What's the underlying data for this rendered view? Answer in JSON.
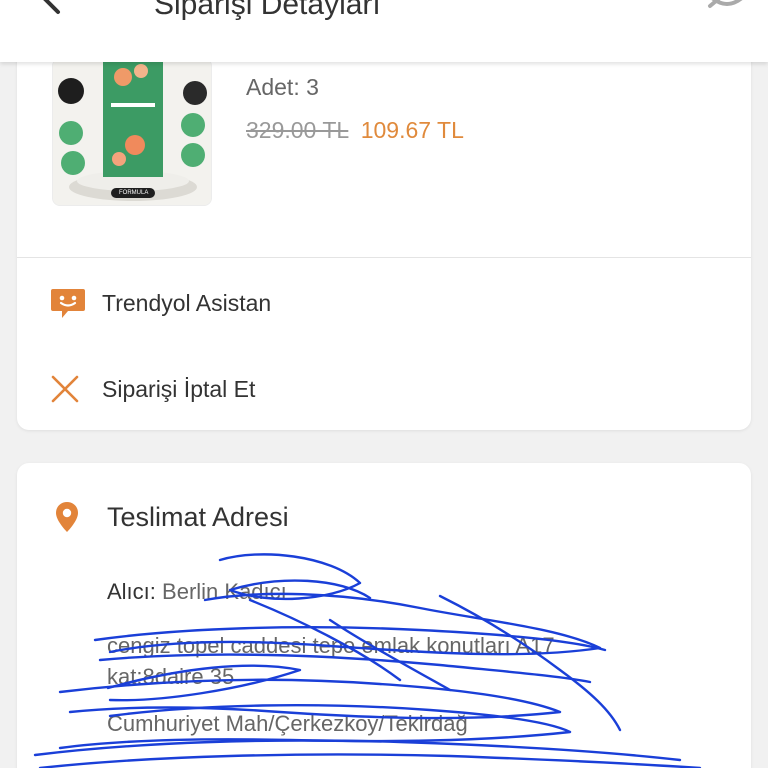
{
  "header": {
    "title": "Siparişi Detayları"
  },
  "product": {
    "quantity": "Adet: 3",
    "old_price": "329.00 TL",
    "new_price": "109.67 TL",
    "image_label": "FORMULA"
  },
  "actions": {
    "assistant_label": "Trendyol Asistan",
    "cancel_label": "Siparişi İptal Et"
  },
  "address": {
    "title": "Teslimat Adresi",
    "recipient_label": "Alıcı:",
    "recipient_name": "Berlin Kadıcı",
    "street": "cengiz topel caddesi tepe emlak konutları A17",
    "street_2": "kat:8daire 35",
    "city": "Cumhuriyet Mah/Çerkezköy/Tekirdağ"
  },
  "colors": {
    "accent": "#e08a3c",
    "scribble": "#1a3fd8",
    "icon_orange": "#e2843a"
  }
}
